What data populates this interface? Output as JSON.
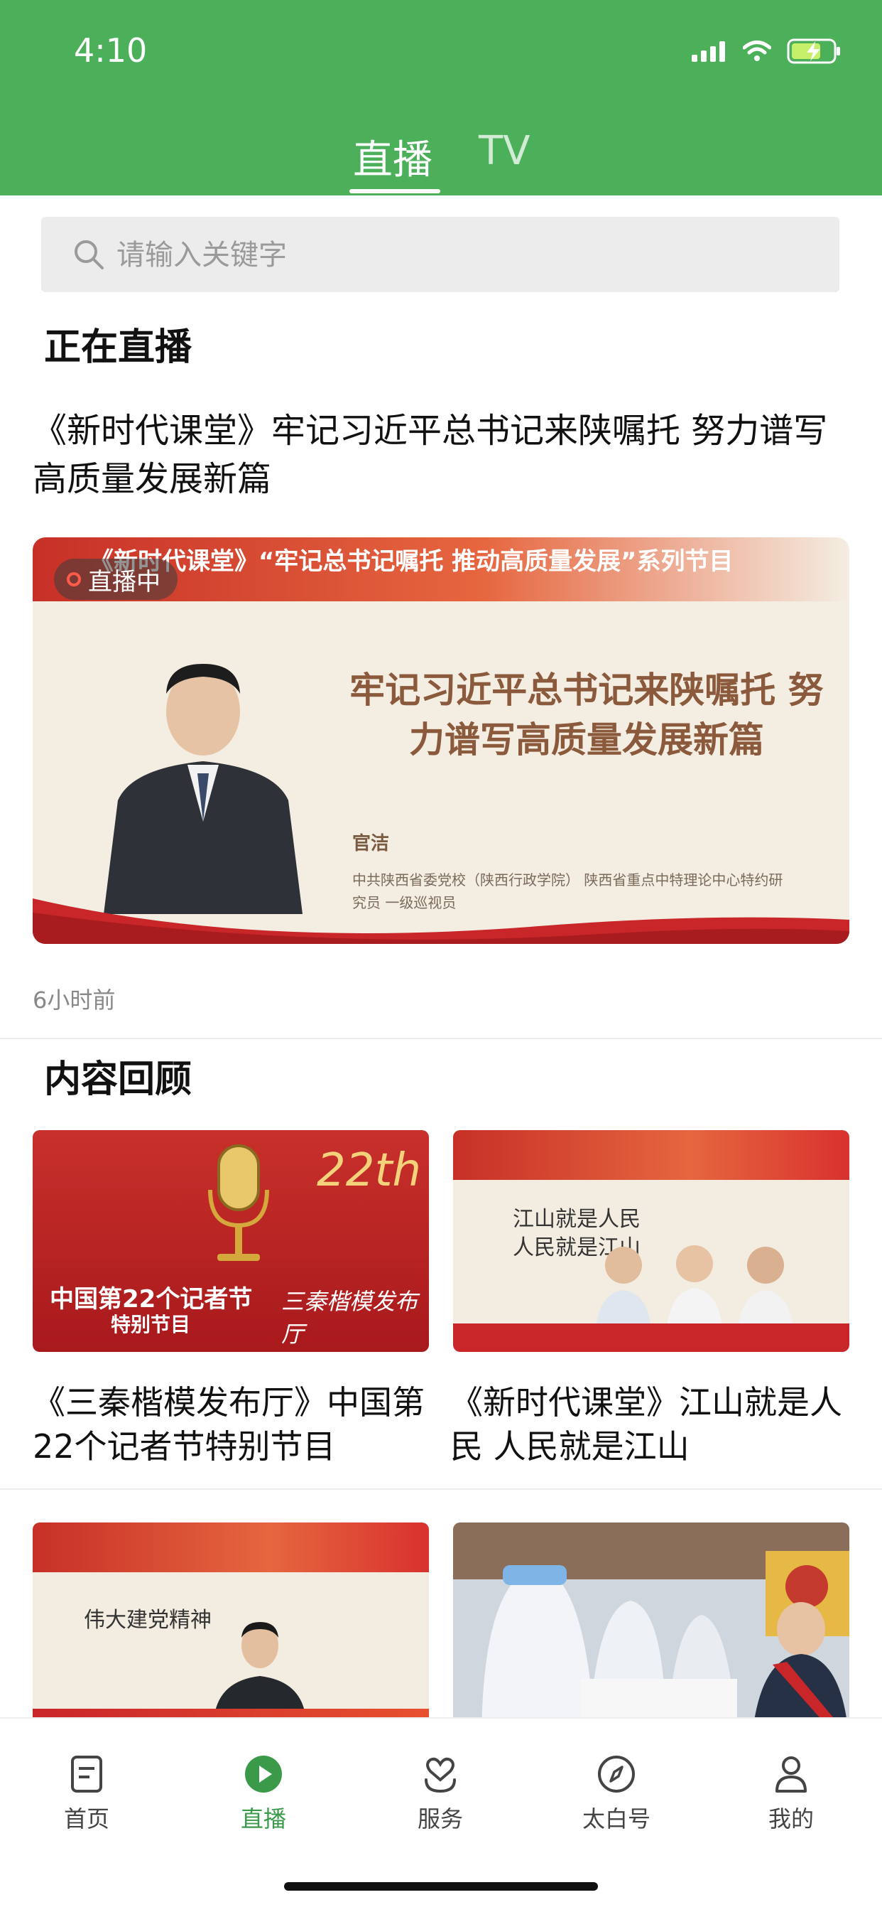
{
  "status_bar": {
    "time": "4:10"
  },
  "tabs": [
    {
      "label": "直播",
      "active": true
    },
    {
      "label": "TV",
      "active": false
    }
  ],
  "search": {
    "placeholder": "请输入关键字"
  },
  "live_section": {
    "title": "正在直播",
    "item": {
      "title": "《新时代课堂》牢记习近平总书记来陕嘱托 努力谱写高质量发展新篇",
      "badge": "直播中",
      "banner_top_text": "《新时代课堂》“牢记总书记嘱托 推动高质量发展”系列节目",
      "banner_headline": "牢记习近平总书记来陕嘱托 努力谱写高质量发展新篇",
      "speaker_name": "官洁",
      "speaker_info": "中共陕西省委党校（陕西行政学院） 陕西省重点中特理论中心特约研究员 一级巡视员",
      "time_ago": "6小时前"
    }
  },
  "review_section": {
    "title": "内容回顾",
    "items": [
      {
        "title": "《三秦楷模发布厅》中国第22个记者节特别节目",
        "thumb_text_1": "中国第22个记者节",
        "thumb_text_2": "特别节目",
        "thumb_text_3": "三秦楷模发布厅",
        "thumb_text_4": "22th"
      },
      {
        "title": "《新时代课堂》江山就是人民 人民就是江山",
        "thumb_text_1": "江山就是人民",
        "thumb_text_2": "人民就是江山"
      },
      {
        "title": "",
        "thumb_text_1": "伟大建党精神"
      },
      {
        "title": ""
      }
    ]
  },
  "bottom_nav": [
    {
      "label": "首页",
      "icon": "home-doc-icon",
      "active": false
    },
    {
      "label": "直播",
      "icon": "play-circle-icon",
      "active": true
    },
    {
      "label": "服务",
      "icon": "service-heart-icon",
      "active": false
    },
    {
      "label": "太白号",
      "icon": "compass-icon",
      "active": false
    },
    {
      "label": "我的",
      "icon": "profile-icon",
      "active": false
    }
  ],
  "colors": {
    "brand_green": "#4caf5a",
    "active_nav": "#3a9a4a"
  }
}
